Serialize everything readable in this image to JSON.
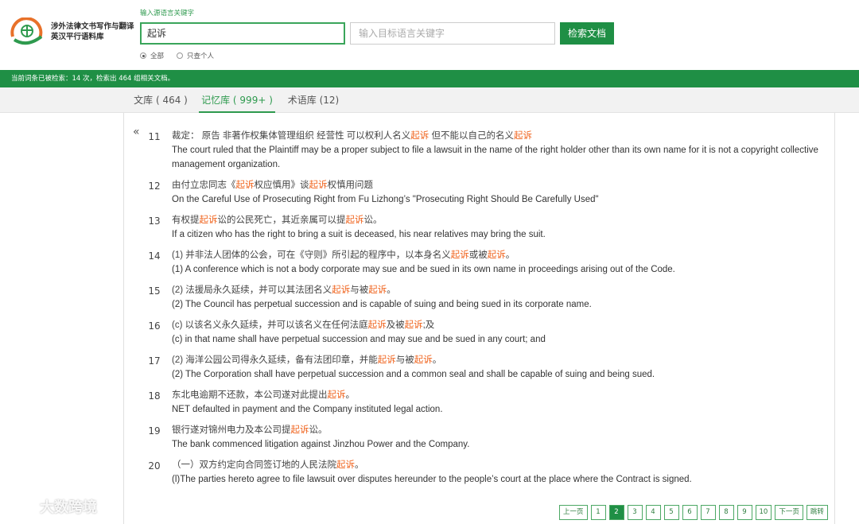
{
  "header": {
    "logo_line1": "涉外法律文书写作与翻译",
    "logo_line2": "英汉平行语料库",
    "src_hint": "输入源语言关键字",
    "src_value": "起诉",
    "tgt_placeholder": "输入目标语言关键字",
    "search_button": "检索文档",
    "radio_all": "全部",
    "radio_personal": "只查个人"
  },
  "status": "当前词条已被检索：14 次，检索出 464 组相关文档。",
  "tabs": [
    {
      "label": "文库 ( 464 )"
    },
    {
      "label": "记忆库 ( 999+ )"
    },
    {
      "label": "术语库 (12)"
    }
  ],
  "collapse_label": "«",
  "entries": [
    {
      "num": "11",
      "zh_parts": [
        "裁定： 原告 非著作权集体管理组织 经营性 可以权利人名义",
        "起诉",
        " 但不能以自己的名义",
        "起诉",
        ""
      ],
      "en": "The court ruled that the Plaintiff may be a proper subject to file a lawsuit in the name of the right holder other than its own name for it is not a copyright collective management organization."
    },
    {
      "num": "12",
      "zh_parts": [
        "由付立忠同志《",
        "起诉",
        "权应慎用》谈",
        "起诉",
        "权慎用问题"
      ],
      "en": "On the Careful Use of Prosecuting Right from Fu Lizhong’s \"Prosecuting Right Should Be Carefully Used\""
    },
    {
      "num": "13",
      "zh_parts": [
        "有权提",
        "起诉",
        "讼的公民死亡，其近亲属可以提",
        "起诉",
        "讼。"
      ],
      "en": "If a citizen who has the right to bring a suit is deceased, his near relatives may bring the suit."
    },
    {
      "num": "14",
      "zh_parts": [
        "(1) 并非法人团体的公会，可在《守则》所引起的程序中，以本身名义",
        "起诉",
        "或被",
        "起诉",
        "。"
      ],
      "en": "(1) A conference which is not a body corporate may sue and be sued in its own name in proceedings arising out of the Code."
    },
    {
      "num": "15",
      "zh_parts": [
        "(2) 法援局永久延续，并可以其法团名义",
        "起诉",
        "与被",
        "起诉",
        "。"
      ],
      "en": "(2) The Council has perpetual succession and is capable of suing and being sued in its corporate name."
    },
    {
      "num": "16",
      "zh_parts": [
        "(c) 以该名义永久延续，并可以该名义在任何法庭",
        "起诉",
        "及被",
        "起诉",
        ";及"
      ],
      "en": "(c) in that name shall have perpetual succession and may sue and be sued in any court; and"
    },
    {
      "num": "17",
      "zh_parts": [
        "(2) 海洋公园公司得永久延续，备有法团印章，并能",
        "起诉",
        "与被",
        "起诉",
        "。"
      ],
      "en": "(2) The Corporation shall have perpetual succession and a common seal and shall be capable of suing and being sued."
    },
    {
      "num": "18",
      "zh_parts": [
        "东北电逾期不还款，本公司遂对此提出",
        "起诉",
        "。",
        "",
        ""
      ],
      "en": "NET defaulted in payment and the Company instituted legal action."
    },
    {
      "num": "19",
      "zh_parts": [
        "银行遂对锦州电力及本公司提",
        "起诉",
        "讼。",
        "",
        ""
      ],
      "en": "The bank commenced litigation against Jinzhou Power and the Company."
    },
    {
      "num": "20",
      "zh_parts": [
        "（一）双方约定向合同签订地的人民法院",
        "起诉",
        "。",
        "",
        ""
      ],
      "en": "(l)The parties hereto agree to file lawsuit over disputes hereunder to the people’s court at the place where the Contract is signed."
    }
  ],
  "pagination": {
    "prev": "上一页",
    "pages": [
      "1",
      "2",
      "3",
      "4",
      "5",
      "6",
      "7",
      "8",
      "9",
      "10"
    ],
    "current": "2",
    "next": "下一页",
    "jump": "跳转"
  },
  "watermark": "大数跨境",
  "colors": {
    "brand_green": "#1f8f45",
    "highlight": "#f0641e"
  }
}
